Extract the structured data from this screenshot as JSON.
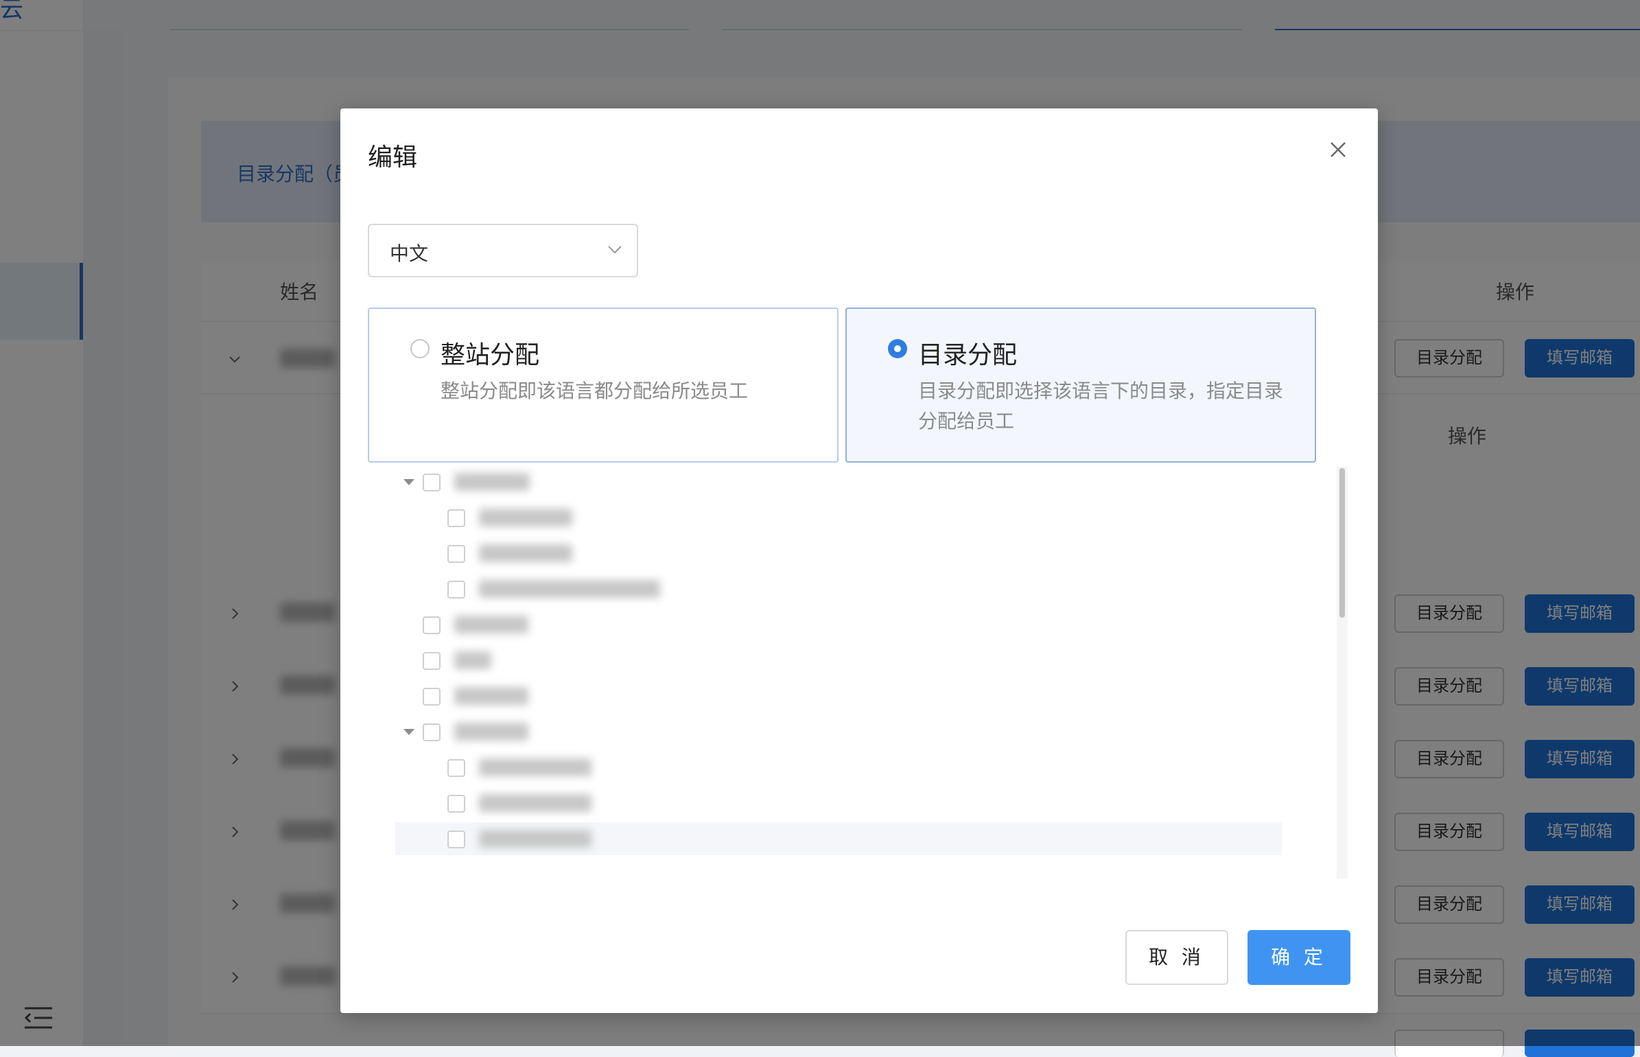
{
  "background": {
    "logo_fragment": "云",
    "tab_label": "目录分配（员",
    "table": {
      "col_name": "姓名",
      "col_ops": "操作",
      "sub_ops": "操作",
      "rows": [
        {
          "btn_assign": "目录分配",
          "btn_email": "填写邮箱"
        },
        {
          "btn_assign": "目录分配",
          "btn_email": "填写邮箱"
        },
        {
          "btn_assign": "目录分配",
          "btn_email": "填写邮箱"
        },
        {
          "btn_assign": "目录分配",
          "btn_email": "填写邮箱"
        },
        {
          "btn_assign": "目录分配",
          "btn_email": "填写邮箱"
        },
        {
          "btn_assign": "目录分配",
          "btn_email": "填写邮箱"
        },
        {
          "btn_assign": "目录分配",
          "btn_email": "填写邮箱"
        }
      ]
    }
  },
  "modal": {
    "title": "编辑",
    "language_select": {
      "value": "中文"
    },
    "modes": [
      {
        "title": "整站分配",
        "desc": "整站分配即该语言都分配给所选员工",
        "selected": false
      },
      {
        "title": "目录分配",
        "desc": "目录分配即选择该语言下的目录，指定目录分配给员工",
        "selected": true
      }
    ],
    "tree": {
      "visible_nodes": 11,
      "labels_obscured": true
    },
    "buttons": {
      "cancel": "取 消",
      "ok": "确 定"
    },
    "accent_color": "#3f94f2"
  }
}
